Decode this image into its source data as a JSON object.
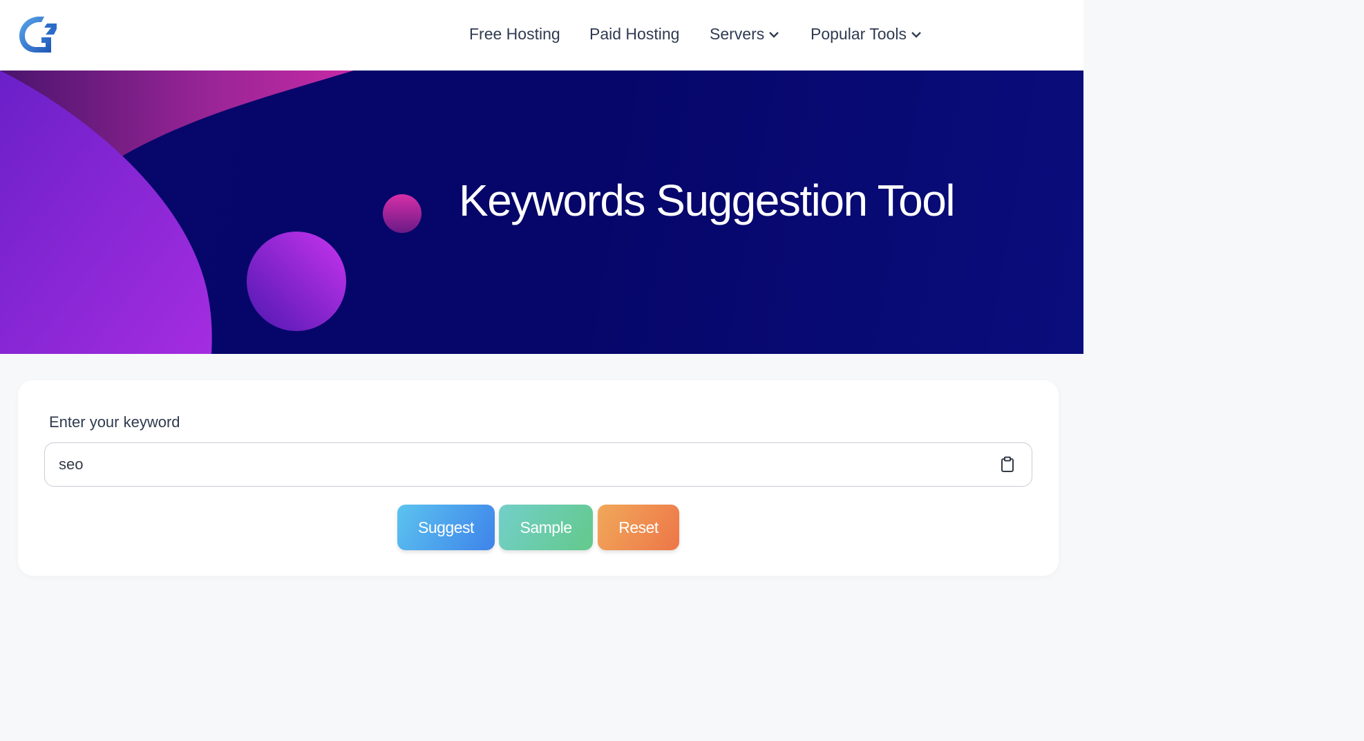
{
  "header": {
    "logo_alt": "logo",
    "nav": [
      {
        "label": "Free Hosting",
        "has_dropdown": false
      },
      {
        "label": "Paid Hosting",
        "has_dropdown": false
      },
      {
        "label": "Servers",
        "has_dropdown": true
      },
      {
        "label": "Popular Tools",
        "has_dropdown": true
      }
    ]
  },
  "hero": {
    "title": "Keywords Suggestion Tool"
  },
  "form": {
    "label": "Enter your keyword",
    "input_value": "seo",
    "paste_icon": "clipboard-icon",
    "buttons": {
      "suggest": "Suggest",
      "sample": "Sample",
      "reset": "Reset"
    }
  },
  "colors": {
    "hero_bg": "#06066a",
    "suggest": "#3e83ea",
    "sample": "#62c98b",
    "reset": "#ee7648"
  }
}
